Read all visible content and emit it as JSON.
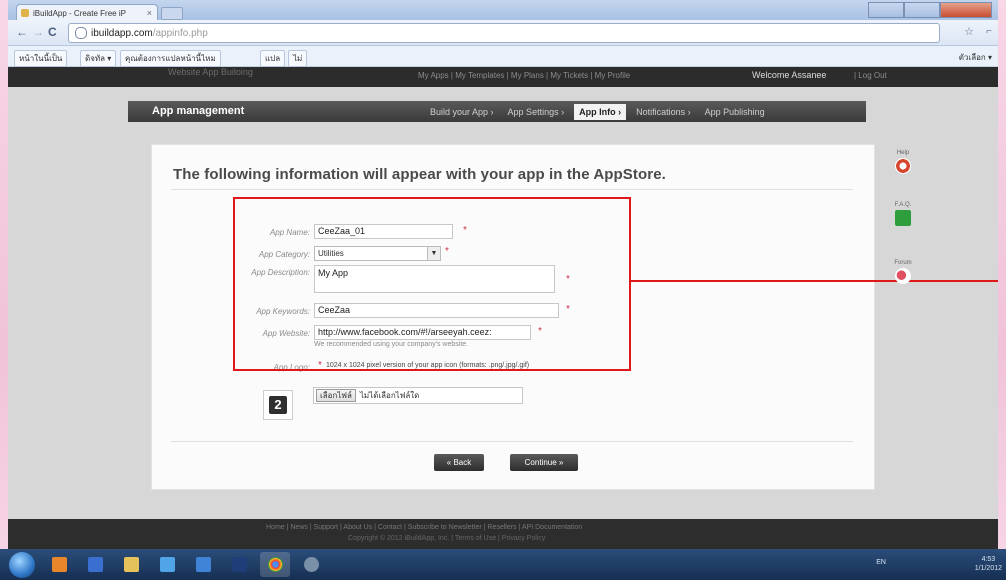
{
  "browser": {
    "tab_title": "iBuildApp - Create Free iP",
    "tab_close": "×",
    "url_domain": "ibuildapp.com",
    "url_path": "/appinfo.php",
    "back": "←",
    "forward": "→",
    "reload": "C",
    "star": "☆",
    "wrench": "⌐"
  },
  "bookmarks": [
    "หน้าในนี้เป็น",
    "ดิจทัล ▾",
    "คุณต้องการแปลหน้านี้ไหม",
    "แปล",
    "ไม่"
  ],
  "bookmarks_other": "ตัวเลือก ▾",
  "site": {
    "brand": "Website App Builoing",
    "top_links": "My Apps  |  My Templates  |  My Plans  |  My Tickets  |  My Profile",
    "welcome": "Welcome Assanee",
    "logout": "|  Log Out"
  },
  "appbar": {
    "title": "App management",
    "steps": [
      "Build your App ›",
      "App Settings ›",
      "App Info ›",
      "Notifications ›",
      "App Publishing"
    ],
    "active_step": 2
  },
  "heading": "The following information will appear with your app in the AppStore.",
  "form": {
    "app_name_label": "App Name:",
    "app_name_value": "CeeZaa_01",
    "app_category_label": "App Category:",
    "app_category_value": "Utilities",
    "app_description_label": "App Description:",
    "app_description_value": "My App",
    "app_keywords_label": "App Keywords:",
    "app_keywords_value": "CeeZaa",
    "app_website_label": "App Website:",
    "app_website_value": "http://www.facebook.com/#!/arseeyah.ceez:",
    "website_note": "We recommended using your company's website.",
    "app_logo_label": "App Logo:",
    "app_logo_note": "1024 x 1024 pixel version of your app icon (formats: .png/.jpg/.gif)",
    "file_button": "เลือกไฟล์",
    "file_status": "ไม่ได้เลือกไฟล์ใด",
    "required": "*"
  },
  "buttons": {
    "back": "« Back",
    "continue": "Continue »"
  },
  "help": {
    "help_label": "Help",
    "faq_label": "F.A.Q.",
    "forum_label": "Forum"
  },
  "footer": {
    "links": "Home  |  News  |  Support  |  About Us  |  Contact  |  Subscribe to Newsletter  |  Resellers  |  API Documentation",
    "copyright": "Copyright © 2012 iBuildApp, Inc.  |  Terms of Use  |  Privacy Policy"
  },
  "taskbar": {
    "tray": "EN",
    "time": "4:53",
    "date": "1/1/2012"
  },
  "colors": {
    "highlight": "#e01818",
    "required": "#c5324a",
    "appbar": "#3a3a3a"
  }
}
